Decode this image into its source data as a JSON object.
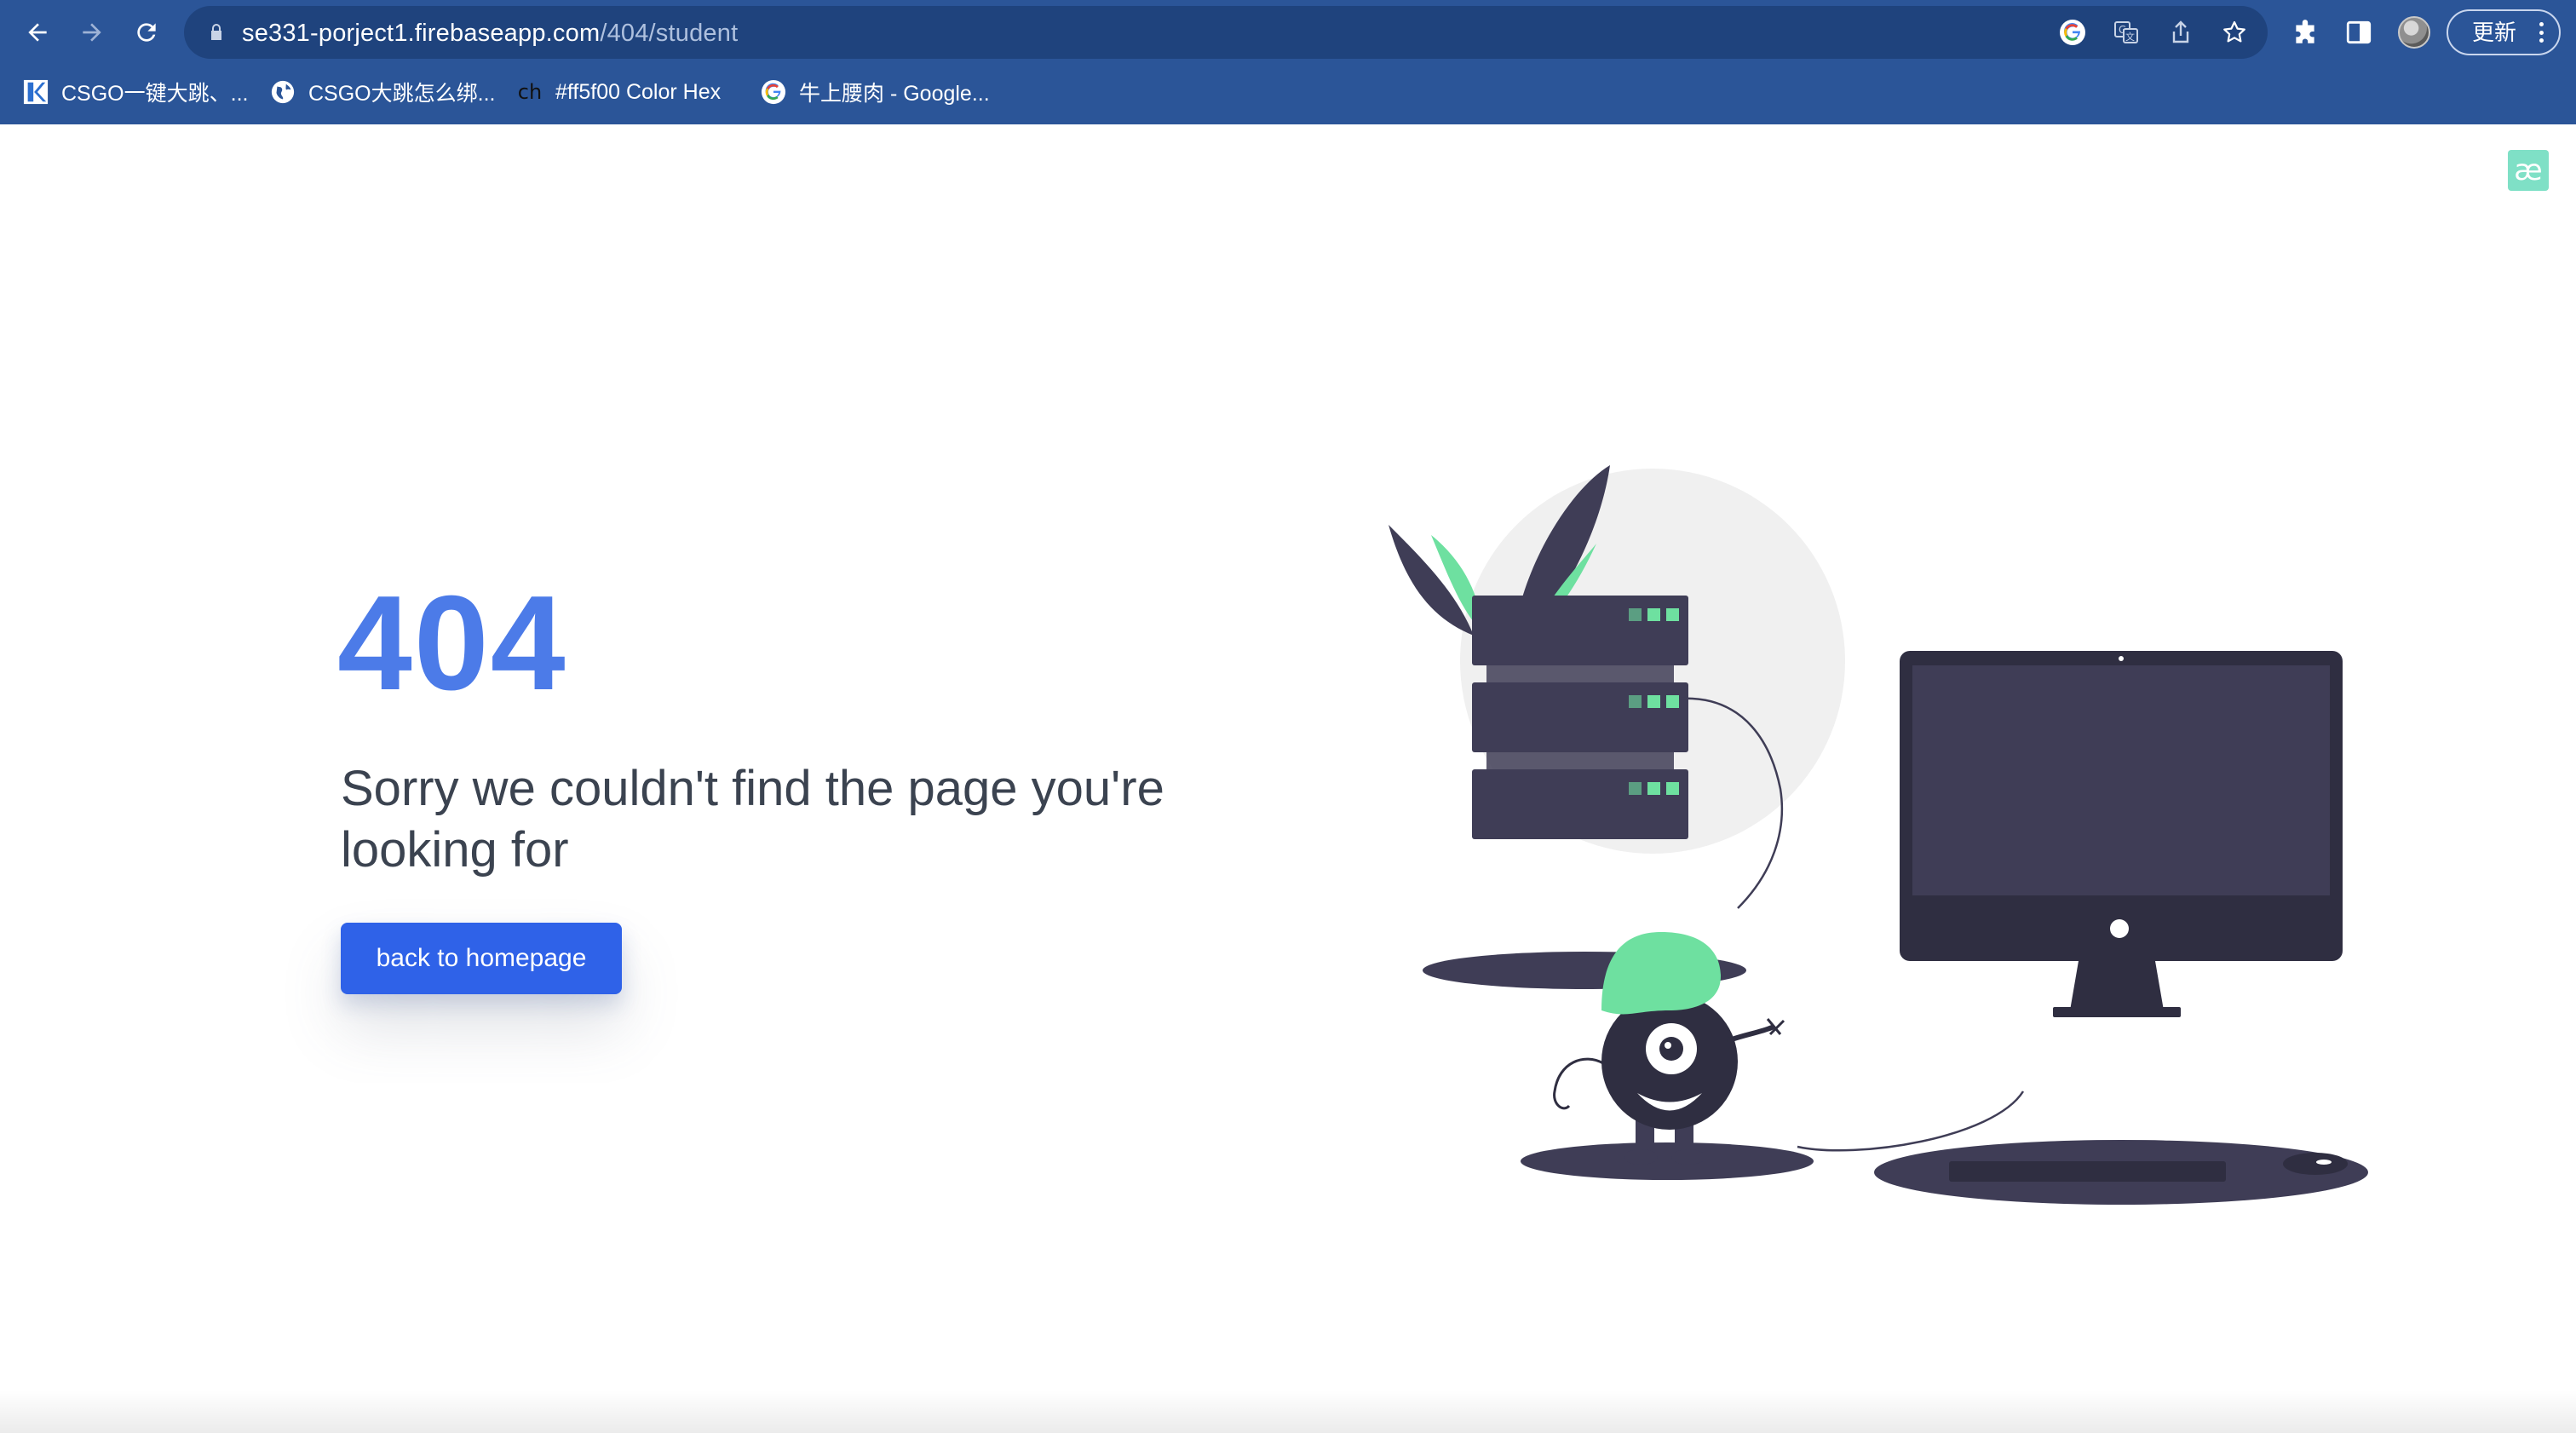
{
  "browser": {
    "url_host": "se331-porject1.firebaseapp.com",
    "url_path": "/404/student",
    "update_label": "更新",
    "bookmarks": [
      {
        "label": "CSGO一键大跳、..."
      },
      {
        "label": "CSGO大跳怎么绑..."
      },
      {
        "label": "#ff5f00 Color Hex",
        "favicon_text": "ch"
      },
      {
        "label": "牛上腰肉 - Google..."
      }
    ],
    "icons": [
      "back-icon",
      "forward-icon",
      "reload-icon",
      "lock-icon",
      "google-icon",
      "translate-icon",
      "share-icon",
      "star-icon",
      "extensions-icon",
      "side-panel-icon",
      "avatar",
      "more-icon"
    ]
  },
  "page": {
    "extension_badge": "æ",
    "error_code": "404",
    "message": "Sorry we couldn't find the page you're looking for",
    "button_label": "back to homepage"
  },
  "colors": {
    "chrome": "#2b5598",
    "accent": "#4c7be8",
    "button": "#2f62e8",
    "illustration_dark": "#3f3d56",
    "illustration_green": "#6ee0a0"
  }
}
